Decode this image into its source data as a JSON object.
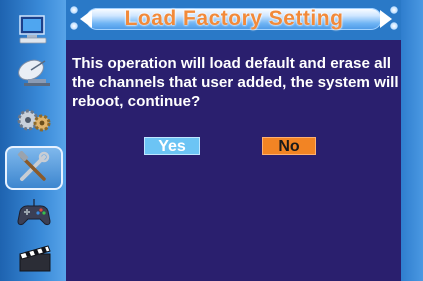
{
  "dialog": {
    "title": "Load Factory Setting",
    "message": "This operation will load default and erase all the channels that user added, the system will reboot, continue?",
    "yes_label": "Yes",
    "no_label": "No"
  },
  "sidebar": {
    "items": [
      {
        "icon": "computer-icon",
        "selected": false
      },
      {
        "icon": "satellite-dish-icon",
        "selected": false
      },
      {
        "icon": "gears-icon",
        "selected": false
      },
      {
        "icon": "tools-icon",
        "selected": true
      },
      {
        "icon": "gamepad-icon",
        "selected": false
      },
      {
        "icon": "clapperboard-icon",
        "selected": false
      }
    ]
  },
  "colors": {
    "panel": "#2a1f6e",
    "frame": "#2a79c7",
    "title_text": "#f28a3a",
    "yes_button": "#6cc4f4",
    "no_button": "#f28424"
  }
}
